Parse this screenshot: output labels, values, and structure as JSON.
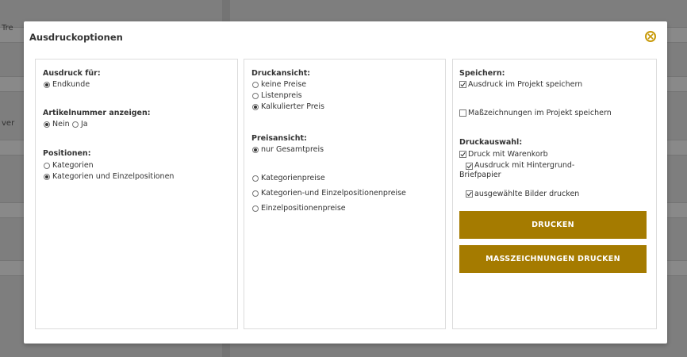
{
  "background": {
    "left_texts": [
      "Tre",
      "ver"
    ]
  },
  "dialog": {
    "title": "Ausdruckoptionen",
    "close_icon": "close-circle-icon",
    "accent_color": "#c89a0a",
    "button_color": "#a57b00"
  },
  "panel1": {
    "ausdruck_label": "Ausdruck für:",
    "ausdruck_options": [
      {
        "label": "Endkunde",
        "selected": true
      }
    ],
    "artikel_label": "Artikelnummer anzeigen:",
    "artikel_options": [
      {
        "label": "Nein",
        "selected": true
      },
      {
        "label": "Ja",
        "selected": false
      }
    ],
    "positionen_label": "Positionen:",
    "positionen_options": [
      {
        "label": "Kategorien",
        "selected": false
      },
      {
        "label": "Kategorien und Einzelpositionen",
        "selected": true
      }
    ]
  },
  "panel2": {
    "druckansicht_label": "Druckansicht:",
    "druckansicht_options": [
      {
        "label": "keine Preise",
        "selected": false
      },
      {
        "label": "Listenpreis",
        "selected": false
      },
      {
        "label": "Kalkulierter Preis",
        "selected": true
      }
    ],
    "preisansicht_label": "Preisansicht:",
    "preisansicht_options": [
      {
        "label": "nur Gesamtpreis",
        "selected": true
      },
      {
        "label": "Kategorienpreise",
        "selected": false
      },
      {
        "label": "Kategorien-und Einzelpositionenpreise",
        "selected": false
      },
      {
        "label": "Einzelpositionenpreise",
        "selected": false
      }
    ]
  },
  "panel3": {
    "speichern_label": "Speichern:",
    "speichern_options": [
      {
        "label": "Ausdruck im Projekt speichern",
        "checked": true
      },
      {
        "label": "Maßzeichnungen im Projekt speichern",
        "checked": false
      }
    ],
    "druckauswahl_label": "Druckauswahl:",
    "druckauswahl_options": [
      {
        "label": "Druck mit Warenkorb",
        "checked": true
      },
      {
        "label": "Ausdruck mit Hintergrund-Briefpapier",
        "checked": true
      },
      {
        "label": "ausgewählte Bilder drucken",
        "checked": true
      }
    ],
    "print_button": "DRUCKEN",
    "print_dimensions_button": "MASSZEICHNUNGEN DRUCKEN"
  }
}
